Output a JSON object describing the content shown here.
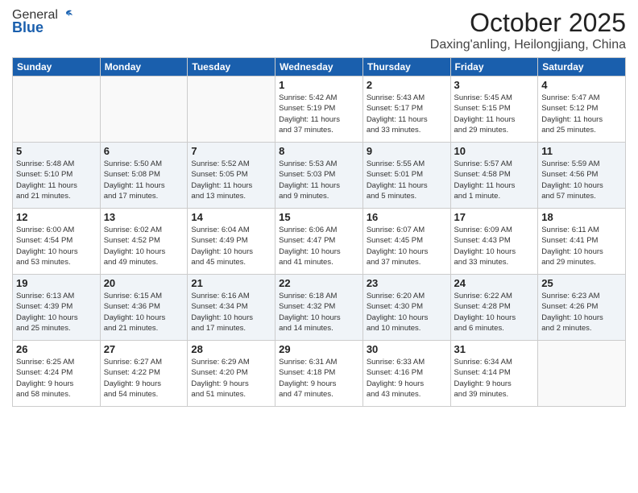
{
  "logo": {
    "general": "General",
    "blue": "Blue"
  },
  "header": {
    "month": "October 2025",
    "location": "Daxing'anling, Heilongjiang, China"
  },
  "weekdays": [
    "Sunday",
    "Monday",
    "Tuesday",
    "Wednesday",
    "Thursday",
    "Friday",
    "Saturday"
  ],
  "weeks": [
    [
      {
        "day": "",
        "info": ""
      },
      {
        "day": "",
        "info": ""
      },
      {
        "day": "",
        "info": ""
      },
      {
        "day": "1",
        "info": "Sunrise: 5:42 AM\nSunset: 5:19 PM\nDaylight: 11 hours\nand 37 minutes."
      },
      {
        "day": "2",
        "info": "Sunrise: 5:43 AM\nSunset: 5:17 PM\nDaylight: 11 hours\nand 33 minutes."
      },
      {
        "day": "3",
        "info": "Sunrise: 5:45 AM\nSunset: 5:15 PM\nDaylight: 11 hours\nand 29 minutes."
      },
      {
        "day": "4",
        "info": "Sunrise: 5:47 AM\nSunset: 5:12 PM\nDaylight: 11 hours\nand 25 minutes."
      }
    ],
    [
      {
        "day": "5",
        "info": "Sunrise: 5:48 AM\nSunset: 5:10 PM\nDaylight: 11 hours\nand 21 minutes."
      },
      {
        "day": "6",
        "info": "Sunrise: 5:50 AM\nSunset: 5:08 PM\nDaylight: 11 hours\nand 17 minutes."
      },
      {
        "day": "7",
        "info": "Sunrise: 5:52 AM\nSunset: 5:05 PM\nDaylight: 11 hours\nand 13 minutes."
      },
      {
        "day": "8",
        "info": "Sunrise: 5:53 AM\nSunset: 5:03 PM\nDaylight: 11 hours\nand 9 minutes."
      },
      {
        "day": "9",
        "info": "Sunrise: 5:55 AM\nSunset: 5:01 PM\nDaylight: 11 hours\nand 5 minutes."
      },
      {
        "day": "10",
        "info": "Sunrise: 5:57 AM\nSunset: 4:58 PM\nDaylight: 11 hours\nand 1 minute."
      },
      {
        "day": "11",
        "info": "Sunrise: 5:59 AM\nSunset: 4:56 PM\nDaylight: 10 hours\nand 57 minutes."
      }
    ],
    [
      {
        "day": "12",
        "info": "Sunrise: 6:00 AM\nSunset: 4:54 PM\nDaylight: 10 hours\nand 53 minutes."
      },
      {
        "day": "13",
        "info": "Sunrise: 6:02 AM\nSunset: 4:52 PM\nDaylight: 10 hours\nand 49 minutes."
      },
      {
        "day": "14",
        "info": "Sunrise: 6:04 AM\nSunset: 4:49 PM\nDaylight: 10 hours\nand 45 minutes."
      },
      {
        "day": "15",
        "info": "Sunrise: 6:06 AM\nSunset: 4:47 PM\nDaylight: 10 hours\nand 41 minutes."
      },
      {
        "day": "16",
        "info": "Sunrise: 6:07 AM\nSunset: 4:45 PM\nDaylight: 10 hours\nand 37 minutes."
      },
      {
        "day": "17",
        "info": "Sunrise: 6:09 AM\nSunset: 4:43 PM\nDaylight: 10 hours\nand 33 minutes."
      },
      {
        "day": "18",
        "info": "Sunrise: 6:11 AM\nSunset: 4:41 PM\nDaylight: 10 hours\nand 29 minutes."
      }
    ],
    [
      {
        "day": "19",
        "info": "Sunrise: 6:13 AM\nSunset: 4:39 PM\nDaylight: 10 hours\nand 25 minutes."
      },
      {
        "day": "20",
        "info": "Sunrise: 6:15 AM\nSunset: 4:36 PM\nDaylight: 10 hours\nand 21 minutes."
      },
      {
        "day": "21",
        "info": "Sunrise: 6:16 AM\nSunset: 4:34 PM\nDaylight: 10 hours\nand 17 minutes."
      },
      {
        "day": "22",
        "info": "Sunrise: 6:18 AM\nSunset: 4:32 PM\nDaylight: 10 hours\nand 14 minutes."
      },
      {
        "day": "23",
        "info": "Sunrise: 6:20 AM\nSunset: 4:30 PM\nDaylight: 10 hours\nand 10 minutes."
      },
      {
        "day": "24",
        "info": "Sunrise: 6:22 AM\nSunset: 4:28 PM\nDaylight: 10 hours\nand 6 minutes."
      },
      {
        "day": "25",
        "info": "Sunrise: 6:23 AM\nSunset: 4:26 PM\nDaylight: 10 hours\nand 2 minutes."
      }
    ],
    [
      {
        "day": "26",
        "info": "Sunrise: 6:25 AM\nSunset: 4:24 PM\nDaylight: 9 hours\nand 58 minutes."
      },
      {
        "day": "27",
        "info": "Sunrise: 6:27 AM\nSunset: 4:22 PM\nDaylight: 9 hours\nand 54 minutes."
      },
      {
        "day": "28",
        "info": "Sunrise: 6:29 AM\nSunset: 4:20 PM\nDaylight: 9 hours\nand 51 minutes."
      },
      {
        "day": "29",
        "info": "Sunrise: 6:31 AM\nSunset: 4:18 PM\nDaylight: 9 hours\nand 47 minutes."
      },
      {
        "day": "30",
        "info": "Sunrise: 6:33 AM\nSunset: 4:16 PM\nDaylight: 9 hours\nand 43 minutes."
      },
      {
        "day": "31",
        "info": "Sunrise: 6:34 AM\nSunset: 4:14 PM\nDaylight: 9 hours\nand 39 minutes."
      },
      {
        "day": "",
        "info": ""
      }
    ]
  ]
}
